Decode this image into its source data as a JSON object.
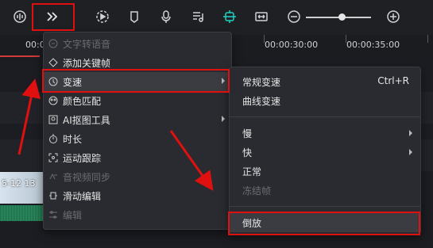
{
  "toolbar": {
    "icons": [
      "audio-waveform-icon",
      "more-chevrons-icon",
      "play-circle-icon",
      "marker-icon",
      "microphone-icon",
      "music-note-icon",
      "ai-split-icon",
      "fit-icon",
      "zoom-out-icon",
      "zoom-in-icon"
    ],
    "accent": "#1fd1c3"
  },
  "ruler": {
    "left_code": "00:0",
    "mid_code": "00:00:30:00",
    "right_code": "00:00:35:00"
  },
  "clip": {
    "timestamp": "5-12 13"
  },
  "context_menu": {
    "items": [
      {
        "label": "文字转语音",
        "disabled": true,
        "submenu": false
      },
      {
        "label": "添加关键帧",
        "disabled": false,
        "submenu": false
      },
      {
        "label": "变速",
        "disabled": false,
        "submenu": true
      },
      {
        "label": "颜色匹配",
        "disabled": false,
        "submenu": false
      },
      {
        "label": "AI抠图工具",
        "disabled": false,
        "submenu": true
      },
      {
        "label": "时长",
        "disabled": false,
        "submenu": false
      },
      {
        "label": "运动跟踪",
        "disabled": false,
        "submenu": false
      },
      {
        "label": "音视频同步",
        "disabled": true,
        "submenu": false
      },
      {
        "label": "滑动编辑",
        "disabled": false,
        "submenu": false
      },
      {
        "label": "编辑",
        "disabled": true,
        "submenu": false
      }
    ]
  },
  "speed_submenu": {
    "normal_speed": "常规变速",
    "normal_speed_shortcut": "Ctrl+R",
    "curve_speed": "曲线变速",
    "slow": "慢",
    "fast": "快",
    "normal": "正常",
    "freeze_frame": "冻结帧",
    "reverse": "倒放"
  },
  "colors": {
    "highlight_box": "#e01010",
    "menu_bg": "#2a2b30"
  }
}
